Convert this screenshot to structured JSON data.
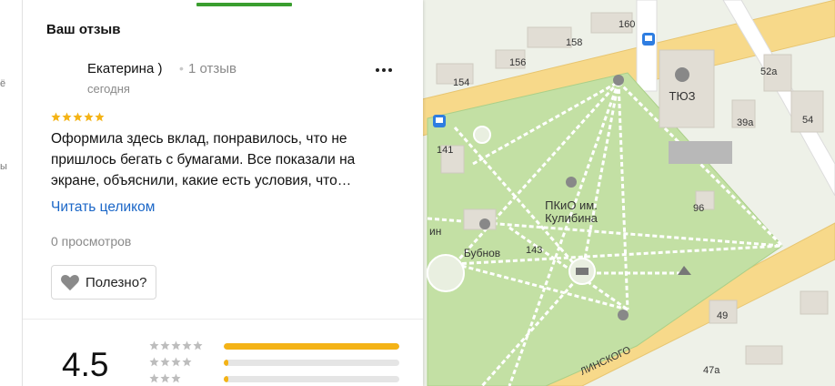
{
  "review_panel": {
    "section_title": "Ваш отзыв",
    "author": {
      "name": "Екатерина )",
      "reviews_count": "1 отзыв",
      "date": "сегодня"
    },
    "rating_stars": 5,
    "text": "Оформила здесь вклад, понравилось, что не пришлось бегать с бумагами. Все показали на экране, объяснили, какие есть условия, что…",
    "read_more_label": "Читать целиком",
    "views_label": "0 просмотров",
    "helpful_label": "Полезно?"
  },
  "rating_summary": {
    "value": "4.5",
    "distribution": [
      {
        "stars": 5,
        "fraction": 1.0
      },
      {
        "stars": 4,
        "fraction": 0.02
      },
      {
        "stars": 3,
        "fraction": 0.02
      }
    ]
  },
  "colors": {
    "accent_green": "#3a9e2f",
    "star_yellow": "#f4b316",
    "link_blue": "#1a66c7",
    "park_green": "#c3e0a4",
    "road_orange": "#f7d98a"
  },
  "left_strip": {
    "glyph_1": "ё",
    "glyph_2": "ы"
  },
  "map": {
    "park_name_line1": "ПКиО им.",
    "park_name_line2": "Кулибина",
    "theatre": "ТЮЗ",
    "monument": "Бубнов",
    "street_fragment": "ЛИНСКОГО",
    "partial_label": "ин",
    "house_numbers": [
      "160",
      "158",
      "156",
      "154",
      "52а",
      "54",
      "39а",
      "141",
      "96",
      "143",
      "49",
      "47а"
    ]
  }
}
